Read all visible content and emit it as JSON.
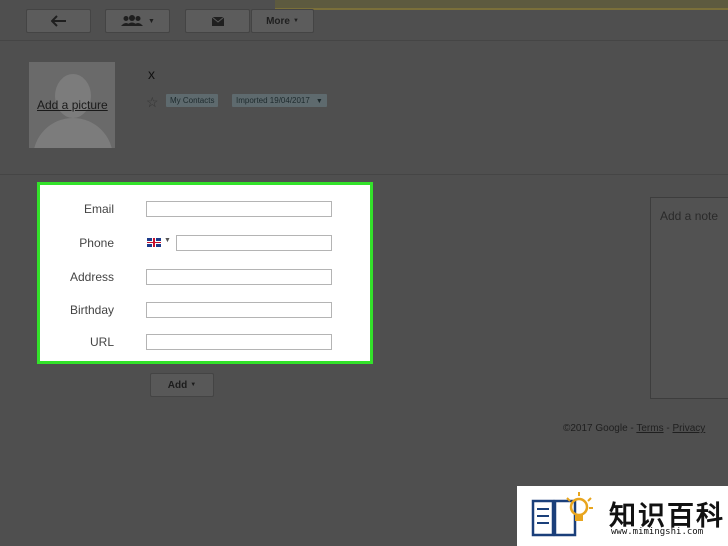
{
  "toolbar": {
    "more_label": "More"
  },
  "contact": {
    "add_picture_label": "Add a picture",
    "name": "x",
    "chips": [
      {
        "label": "My Contacts"
      },
      {
        "label": "Imported 19/04/2017"
      }
    ]
  },
  "form": {
    "fields": [
      {
        "label": "Email",
        "value": ""
      },
      {
        "label": "Phone",
        "value": ""
      },
      {
        "label": "Address",
        "value": ""
      },
      {
        "label": "Birthday",
        "value": ""
      },
      {
        "label": "URL",
        "value": ""
      }
    ],
    "add_button_label": "Add"
  },
  "note": {
    "placeholder": "Add a note"
  },
  "footer": {
    "copyright": "©2017 Google",
    "terms": "Terms",
    "privacy": "Privacy"
  },
  "watermark": {
    "title": "知识百科",
    "url": "www.mimingshi.com"
  },
  "colors": {
    "highlight": "#33e22a",
    "overlay": "#4f4f4f"
  }
}
